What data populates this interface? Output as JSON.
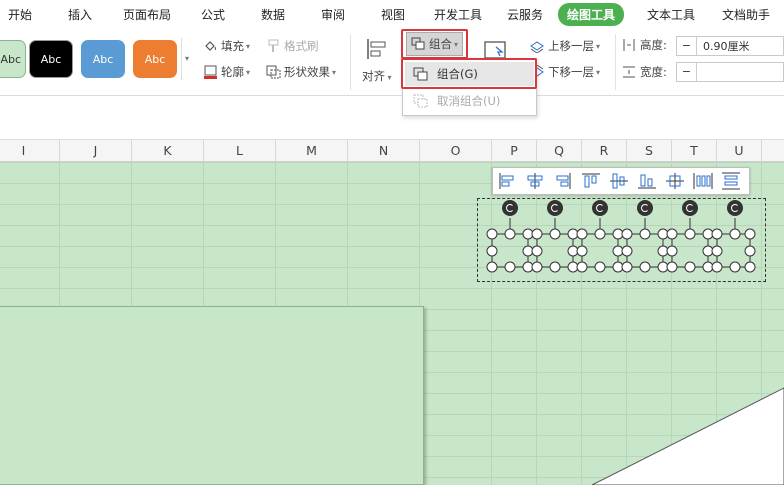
{
  "menu": {
    "items": [
      "开始",
      "插入",
      "页面布局",
      "公式",
      "数据",
      "审阅",
      "视图",
      "开发工具",
      "云服务",
      "绘图工具",
      "文本工具",
      "文档助手"
    ],
    "active": "绘图工具",
    "active_color": "#4caf50"
  },
  "ribbon": {
    "style_swatches": [
      {
        "label": "Abc",
        "bg": "#c8e6c9",
        "fg": "#333333"
      },
      {
        "label": "Abc",
        "bg": "#000000",
        "fg": "#ffffff"
      },
      {
        "label": "Abc",
        "bg": "#5b9bd5",
        "fg": "#ffffff"
      },
      {
        "label": "Abc",
        "bg": "#ed7d31",
        "fg": "#ffffff"
      }
    ],
    "fill_label": "填充",
    "outline_label": "轮廓",
    "format_brush_label": "格式刷",
    "shape_effect_label": "形状效果",
    "align_label": "对齐",
    "group_label": "组合",
    "bring_forward_label": "上移一层",
    "send_backward_label": "下移一层",
    "height_label": "高度:",
    "height_value": "0.90厘米",
    "width_label": "宽度:",
    "width_value": "",
    "height_minus": "−",
    "width_minus": "−"
  },
  "group_menu": {
    "group_item": "组合(G)",
    "ungroup_item": "取消组合(U)"
  },
  "columns": [
    "I",
    "J",
    "K",
    "L",
    "M",
    "N",
    "O",
    "P",
    "Q",
    "R",
    "S",
    "T",
    "U"
  ],
  "align_toolbar": {
    "icons": [
      "align-left-icon",
      "align-center-icon",
      "align-right-icon",
      "align-top-icon",
      "align-middle-icon",
      "align-bottom-icon",
      "center-both-icon",
      "distribute-horizontal-icon",
      "distribute-vertical-icon"
    ]
  },
  "colors": {
    "sheet_green": "#c8e6c9",
    "highlight_red": "#d9363e"
  }
}
